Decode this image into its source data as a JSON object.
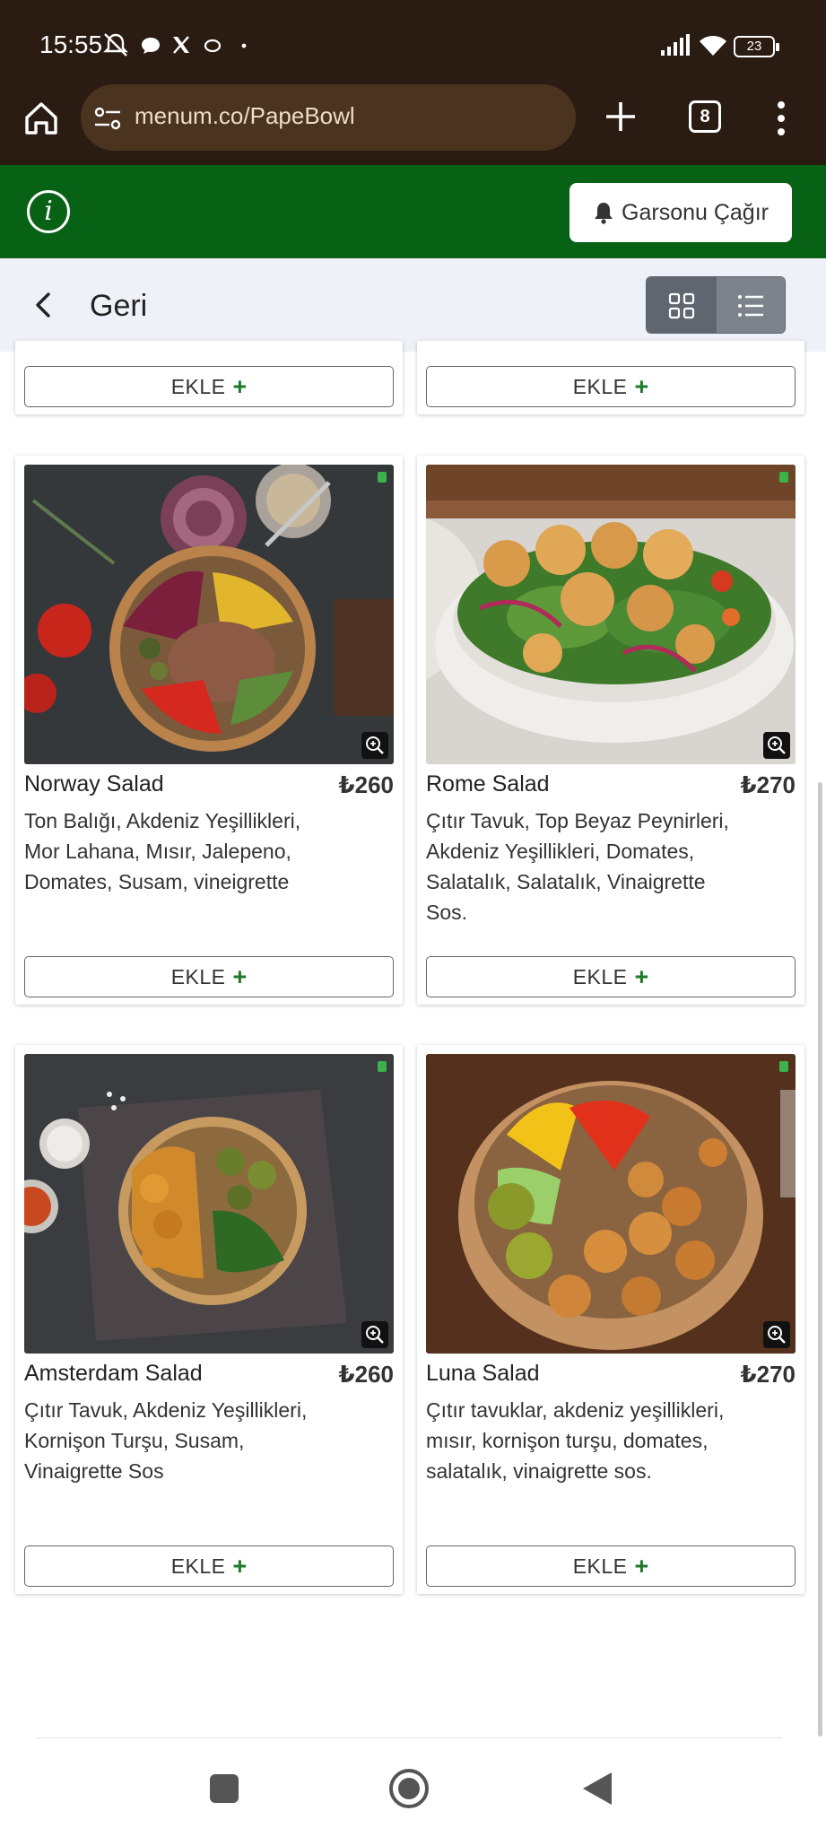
{
  "status_bar": {
    "time": "15:55",
    "battery": "23"
  },
  "browser": {
    "url": "menum.co/PapeBowl",
    "tab_count": "8"
  },
  "header": {
    "waiter_button": "Garsonu Çağır"
  },
  "nav": {
    "back_label": "Geri"
  },
  "add_label": "EKLE",
  "add_plus": "+",
  "products": [
    {
      "name": "Norway Salad",
      "price": "₺260",
      "description": "Ton Balığı, Akdeniz Yeşillikleri, Mor Lahana, Mısır, Jalepeno, Domates, Susam, vineigrette"
    },
    {
      "name": "Rome Salad",
      "price": "₺270",
      "description": "Çıtır Tavuk, Top Beyaz Peynirleri, Akdeniz Yeşillikleri, Domates, Salatalık, Salatalık, Vinaigrette Sos."
    },
    {
      "name": "Amsterdam Salad",
      "price": "₺260",
      "description": "Çıtır Tavuk, Akdeniz Yeşillikleri, Kornişon Turşu, Susam, Vinaigrette Sos"
    },
    {
      "name": "Luna Salad",
      "price": "₺270",
      "description": "Çıtır tavuklar, akdeniz yeşillikleri, mısır, kornişon turşu, domates, salatalık, vinaigrette sos."
    }
  ],
  "colors": {
    "status_bar_bg": "#2a1b13",
    "url_bar_bg": "#4a3420",
    "header_green": "#076215",
    "back_row_bg": "#eef1f7",
    "plus_green": "#1f7a2a"
  }
}
